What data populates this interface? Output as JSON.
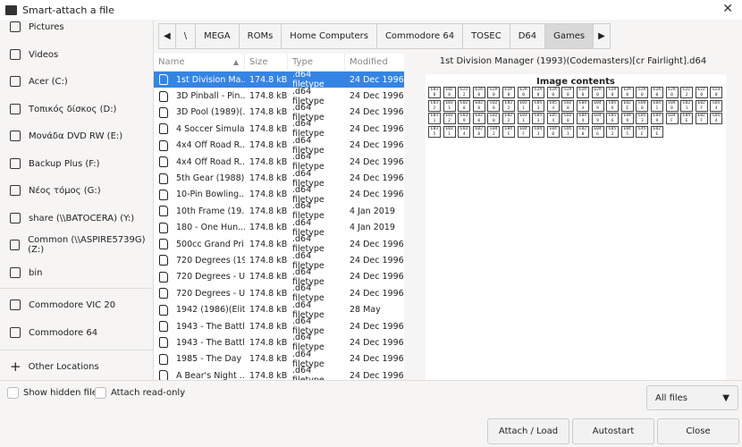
{
  "window": {
    "title": "Smart-attach a file",
    "close_icon": "close-icon"
  },
  "sidebar": {
    "items": [
      {
        "label": "Pictures",
        "icon": "pictures-icon"
      },
      {
        "label": "Videos",
        "icon": "videos-icon"
      },
      {
        "label": "Acer (C:)",
        "icon": "drive-icon"
      },
      {
        "label": "Τοπικός δίσκος (D:)",
        "icon": "drive-icon"
      },
      {
        "label": "Μονάδα DVD RW (E:)",
        "icon": "optical-drive-icon"
      },
      {
        "label": "Backup Plus (F:)",
        "icon": "drive-icon"
      },
      {
        "label": "Νέος τόμος (G:)",
        "icon": "drive-icon"
      },
      {
        "label": "share (\\\\BATOCERA) (Y:)",
        "icon": "network-drive-icon"
      },
      {
        "label": "Common (\\\\ASPIRE5739G) (Z:)",
        "icon": "network-drive-icon"
      },
      {
        "label": "bin",
        "icon": "folder-icon"
      }
    ],
    "bookmarks": [
      {
        "label": "Commodore VIC 20"
      },
      {
        "label": "Commodore 64"
      }
    ],
    "other_locations": "Other Locations"
  },
  "path": [
    "\\",
    "MEGA",
    "ROMs",
    "Home Computers",
    "Commodore 64",
    "TOSEC",
    "D64",
    "Games"
  ],
  "path_selected": "Games",
  "list": {
    "columns": [
      "Name",
      "Size",
      "Type",
      "Modified"
    ],
    "rows": [
      [
        "1st Division Ma...",
        "174.8 kB",
        ".d64 filetype",
        "24 Dec 1996"
      ],
      [
        "3D Pinball - Pin...",
        "174.8 kB",
        ".d64 filetype",
        "24 Dec 1996"
      ],
      [
        "3D Pool (1989)(...",
        "174.8 kB",
        ".d64 filetype",
        "24 Dec 1996"
      ],
      [
        "4 Soccer Simula...",
        "174.8 kB",
        ".d64 filetype",
        "24 Dec 1996"
      ],
      [
        "4x4 Off Road R...",
        "174.8 kB",
        ".d64 filetype",
        "24 Dec 1996"
      ],
      [
        "4x4 Off Road R...",
        "174.8 kB",
        ".d64 filetype",
        "24 Dec 1996"
      ],
      [
        "5th Gear (1988)...",
        "174.8 kB",
        ".d64 filetype",
        "24 Dec 1996"
      ],
      [
        "10-Pin Bowling...",
        "174.8 kB",
        ".d64 filetype",
        "24 Dec 1996"
      ],
      [
        "10th Frame (19...",
        "174.8 kB",
        ".d64 filetype",
        "4 Jan 2019"
      ],
      [
        "180 - One Hun...",
        "174.8 kB",
        ".d64 filetype",
        "4 Jan 2019"
      ],
      [
        "500cc Grand Pri...",
        "174.8 kB",
        ".d64 filetype",
        "24 Dec 1996"
      ],
      [
        "720 Degrees (19...",
        "174.8 kB",
        ".d64 filetype",
        "24 Dec 1996"
      ],
      [
        "720 Degrees - U...",
        "174.8 kB",
        ".d64 filetype",
        "24 Dec 1996"
      ],
      [
        "720 Degrees - U...",
        "174.8 kB",
        ".d64 filetype",
        "24 Dec 1996"
      ],
      [
        "1942 (1986)(Elit...",
        "174.8 kB",
        ".d64 filetype",
        "28 May"
      ],
      [
        "1943 - The Battl...",
        "174.8 kB",
        ".d64 filetype",
        "24 Dec 1996"
      ],
      [
        "1943 - The Battl...",
        "174.8 kB",
        ".d64 filetype",
        "24 Dec 1996"
      ],
      [
        "1985 - The Day ...",
        "174.8 kB",
        ".d64 filetype",
        "24 Dec 1996"
      ],
      [
        "A Bear's Night ...",
        "174.8 kB",
        ".d64 filetype",
        "24 Dec 1996"
      ]
    ],
    "selected_index": 0,
    "sort": "Name ascending",
    "accent": "#3584e4"
  },
  "preview": {
    "filename": "1st Division Manager (1993)(Codemasters)[cr Fairlight].d64",
    "heading": "Image contents",
    "glyph_rows": [
      [
        "E030",
        "E020",
        "E222",
        "E2A0",
        "E2A0",
        "E2A0",
        "E2A0",
        "E2A0",
        "E2A0",
        "E2A0",
        "E2A0",
        "E2A0",
        "E2A0",
        "E2A0",
        "E2A0",
        "E2A0",
        "E2A0",
        "E222",
        "E220",
        "E230"
      ],
      [
        "E032",
        "E031",
        "E020",
        "E020",
        "E020",
        "E022",
        "E031",
        "E053",
        "E054",
        "E020",
        "E044",
        "E049",
        "E056",
        "E02E",
        "E040",
        "E041",
        "E048",
        "E021",
        "E02F",
        "E054"
      ],
      [
        "E031",
        "E032",
        "E039",
        "E020",
        "E020",
        "E022",
        "E031",
        "E053",
        "E054",
        "E020",
        "E044",
        "E049",
        "E056",
        "E049",
        "E053",
        "E049",
        "E04F",
        "E04E",
        "E02F",
        "E054"
      ],
      [
        "E035",
        "E031",
        "E034",
        "E020",
        "E042",
        "E04C",
        "E04F",
        "E043",
        "E04B",
        "E053",
        "E020",
        "E046",
        "E052",
        "E045",
        "E45E",
        "E02E"
      ]
    ]
  },
  "footer": {
    "show_hidden": "Show hidden files",
    "read_only": "Attach read-only",
    "filter": "All files",
    "attach": "Attach / Load",
    "autostart": "Autostart",
    "close": "Close"
  }
}
